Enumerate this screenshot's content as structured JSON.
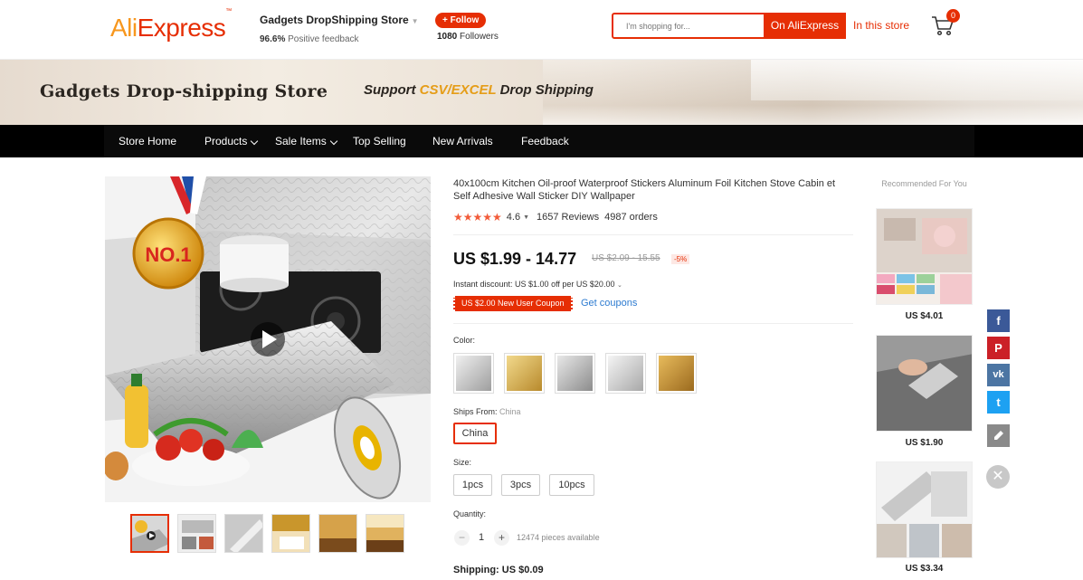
{
  "header": {
    "logo_text": "AliExpress",
    "store_name": "Gadgets DropShipping Store",
    "feedback_pct": "96.6%",
    "feedback_label": "Positive feedback",
    "follow_label": "+ Follow",
    "followers_count": "1080",
    "followers_label": "Followers",
    "search_placeholder": "I'm shopping for...",
    "search_on_ae": "On AliExpress",
    "search_in_store": "In this store",
    "cart_count": "0"
  },
  "banner": {
    "title": "Gadgets Drop-shipping Store",
    "subtitle_pre": "Support ",
    "subtitle_hl": "CSV/EXCEL",
    "subtitle_post": " Drop Shipping"
  },
  "nav": {
    "items": [
      {
        "label": "Store Home"
      },
      {
        "label": "Products"
      },
      {
        "label": "Sale Items"
      },
      {
        "label": "Top Selling"
      },
      {
        "label": "New Arrivals"
      },
      {
        "label": "Feedback"
      }
    ]
  },
  "product": {
    "badge_text": "NO.1",
    "title": "40x100cm Kitchen Oil-proof Waterproof Stickers Aluminum Foil Kitchen Stove Cabin et Self Adhesive Wall Sticker DIY Wallpaper",
    "rating": "4.6",
    "reviews": "1657 Reviews",
    "orders": "4987 orders",
    "price": "US $1.99 - 14.77",
    "old_price": "US $2.09 - 15.55",
    "discount": "-5%",
    "instant_discount": "Instant discount: US $1.00 off per US $20.00",
    "coupon": "US $2.00 New User Coupon",
    "get_coupons": "Get coupons",
    "color_label": "Color:",
    "ships_from_label": "Ships From:",
    "ships_from_value": "China",
    "ships_option": "China",
    "size_label": "Size:",
    "sizes": [
      "1pcs",
      "3pcs",
      "10pcs"
    ],
    "quantity_label": "Quantity:",
    "quantity": "1",
    "available": "12474 pieces available",
    "shipping": "Shipping: US $0.09"
  },
  "recommended": {
    "title": "Recommended For You",
    "items": [
      {
        "price": "US $4.01"
      },
      {
        "price": "US $1.90"
      },
      {
        "price": "US $3.34"
      }
    ]
  },
  "social": {
    "facebook": "f",
    "pinterest": "P",
    "vk": "vk",
    "twitter": "t"
  },
  "colors": {
    "accent": "#e62e04",
    "facebook": "#3b5998",
    "pinterest": "#cb2027",
    "vk": "#4c75a3",
    "twitter": "#1da1f2"
  }
}
